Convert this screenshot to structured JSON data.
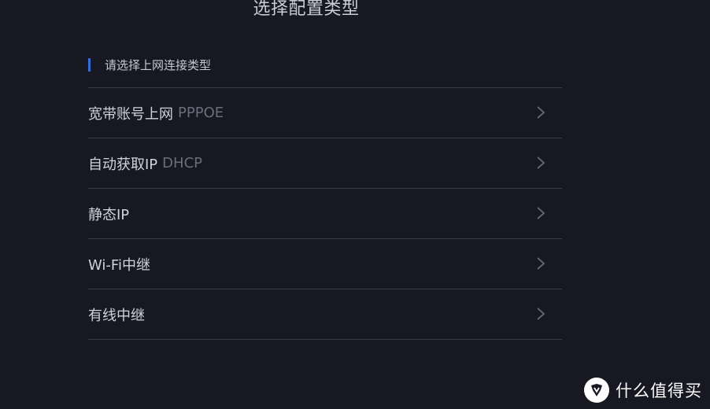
{
  "header": {
    "title": "选择配置类型"
  },
  "section": {
    "label": "请选择上网连接类型",
    "accent_color": "#2f6fdd"
  },
  "options": [
    {
      "label": "宽带账号上网",
      "sub": "PPPOE",
      "icon": "chevron-right-icon"
    },
    {
      "label": "自动获取IP",
      "sub": "DHCP",
      "icon": "chevron-right-icon"
    },
    {
      "label": "静态IP",
      "sub": "",
      "icon": "chevron-right-icon"
    },
    {
      "label": "Wi-Fi中继",
      "sub": "",
      "icon": "chevron-right-icon"
    },
    {
      "label": "有线中继",
      "sub": "",
      "icon": "chevron-right-icon"
    }
  ],
  "watermark": {
    "logo_char": "值",
    "text": "什么值得买"
  }
}
